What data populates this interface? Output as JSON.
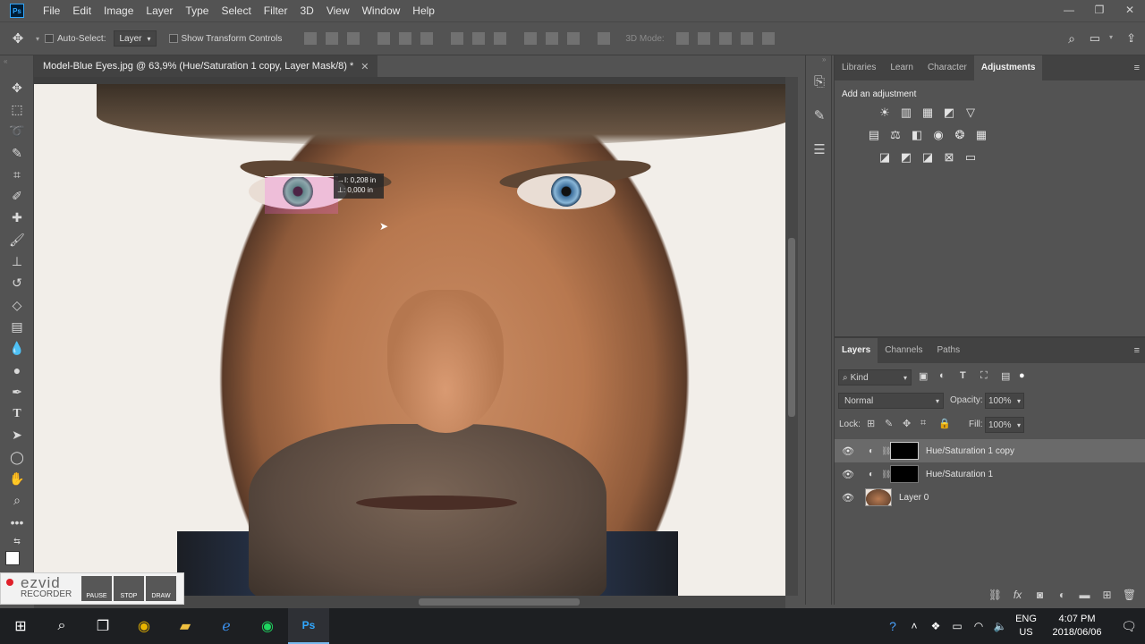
{
  "app": {
    "logo_text": "Ps"
  },
  "menu": [
    "File",
    "Edit",
    "Image",
    "Layer",
    "Type",
    "Select",
    "Filter",
    "3D",
    "View",
    "Window",
    "Help"
  ],
  "options": {
    "auto_select_label": "Auto-Select:",
    "auto_select_target": "Layer",
    "show_transform_label": "Show Transform Controls",
    "mode_3d_label": "3D Mode:"
  },
  "document": {
    "tab_title": "Model-Blue Eyes.jpg @ 63,9% (Hue/Saturation 1 copy, Layer Mask/8) *",
    "measure": {
      "x": "0,208 in",
      "y": "0,000 in"
    }
  },
  "adjustments_panel": {
    "tabs": [
      "Libraries",
      "Learn",
      "Character",
      "Adjustments"
    ],
    "active_tab": "Adjustments",
    "title": "Add an adjustment"
  },
  "layers_panel": {
    "tabs": [
      "Layers",
      "Channels",
      "Paths"
    ],
    "active_tab": "Layers",
    "filter_label": "Kind",
    "blend_mode": "Normal",
    "opacity_label": "Opacity:",
    "opacity_value": "100%",
    "lock_label": "Lock:",
    "fill_label": "Fill:",
    "fill_value": "100%",
    "layers": [
      {
        "name": "Hue/Saturation 1 copy",
        "selected": true
      },
      {
        "name": "Hue/Saturation 1",
        "selected": false
      },
      {
        "name": "Layer 0",
        "selected": false
      }
    ]
  },
  "ezvid": {
    "brand": "ezvid",
    "sub": "RECORDER",
    "buttons": [
      "PAUSE",
      "STOP",
      "DRAW"
    ]
  },
  "taskbar": {
    "language_top": "ENG",
    "language_bottom": "US",
    "time": "4:07 PM",
    "date": "2018/06/06"
  }
}
